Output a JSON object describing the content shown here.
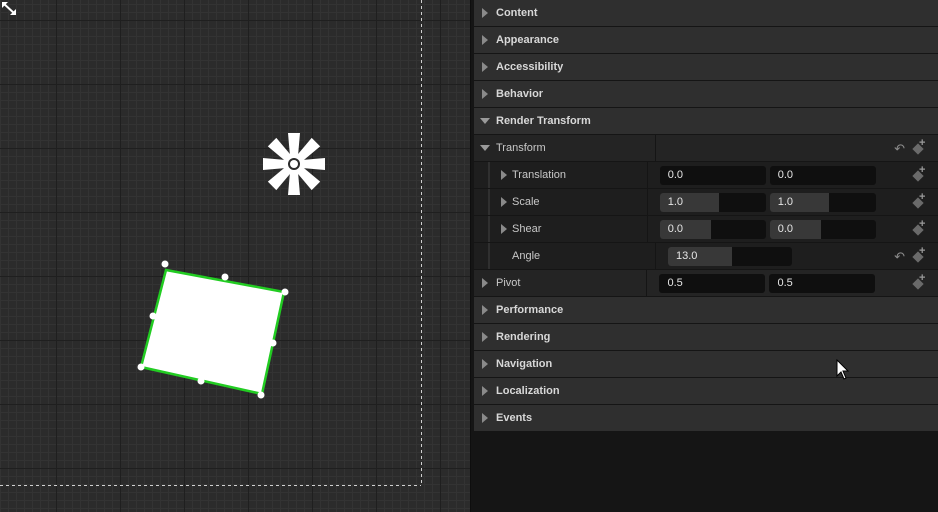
{
  "viewport": {
    "selected_widget": "image-widget",
    "selection_color": "#22cc22",
    "widget_rotation_deg": 13.0,
    "pivot_icon": "pivot-gear-icon",
    "resize_icon": "diagonal-resize-icon"
  },
  "details": {
    "categories_top": [
      {
        "label": "Content"
      },
      {
        "label": "Appearance"
      },
      {
        "label": "Accessibility"
      },
      {
        "label": "Behavior"
      }
    ],
    "render_transform": {
      "label": "Render Transform",
      "transform_label": "Transform",
      "translation": {
        "label": "Translation",
        "x": "0.0",
        "y": "0.0"
      },
      "scale": {
        "label": "Scale",
        "x": "1.0",
        "y": "1.0",
        "x_fill": 0.45,
        "y_fill": 0.55
      },
      "shear": {
        "label": "Shear",
        "x": "0.0",
        "y": "0.0",
        "x_fill": 0.45,
        "y_fill": 0.45
      },
      "angle": {
        "label": "Angle",
        "value": "13.0",
        "fill": 0.5
      },
      "pivot": {
        "label": "Pivot",
        "x": "0.5",
        "y": "0.5"
      }
    },
    "categories_bottom": [
      {
        "label": "Performance"
      },
      {
        "label": "Rendering"
      },
      {
        "label": "Navigation"
      },
      {
        "label": "Localization"
      },
      {
        "label": "Events"
      }
    ]
  }
}
